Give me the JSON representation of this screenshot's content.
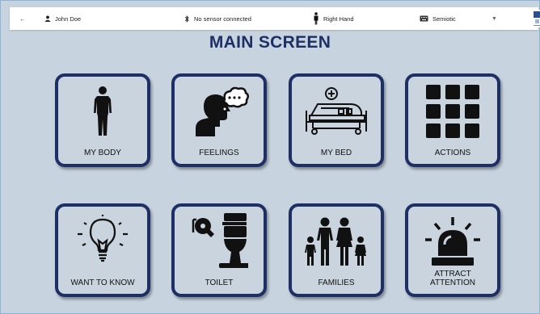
{
  "header": {
    "back_icon": "arrow-left-icon",
    "user_name": "John Doe",
    "sensor_status": "No sensor connected",
    "hand": "Right Hand",
    "language": "Semiotic"
  },
  "page_title": "MAIN SCREEN",
  "tiles": [
    {
      "label": "MY BODY",
      "icon": "human-body-icon"
    },
    {
      "label": "FEELINGS",
      "icon": "head-thought-bubble-icon"
    },
    {
      "label": "MY BED",
      "icon": "hospital-bed-icon"
    },
    {
      "label": "ACTIONS",
      "icon": "grid-icon"
    },
    {
      "label": "WANT TO KNOW",
      "icon": "light-bulb-icon"
    },
    {
      "label": "TOILET",
      "icon": "toilet-icon"
    },
    {
      "label": "FAMILIES",
      "icon": "family-icon"
    },
    {
      "label": "ATTRACT\nATTENTION",
      "icon": "alarm-light-icon"
    }
  ],
  "colors": {
    "accent": "#1e2f66",
    "background": "#c7d3de"
  }
}
